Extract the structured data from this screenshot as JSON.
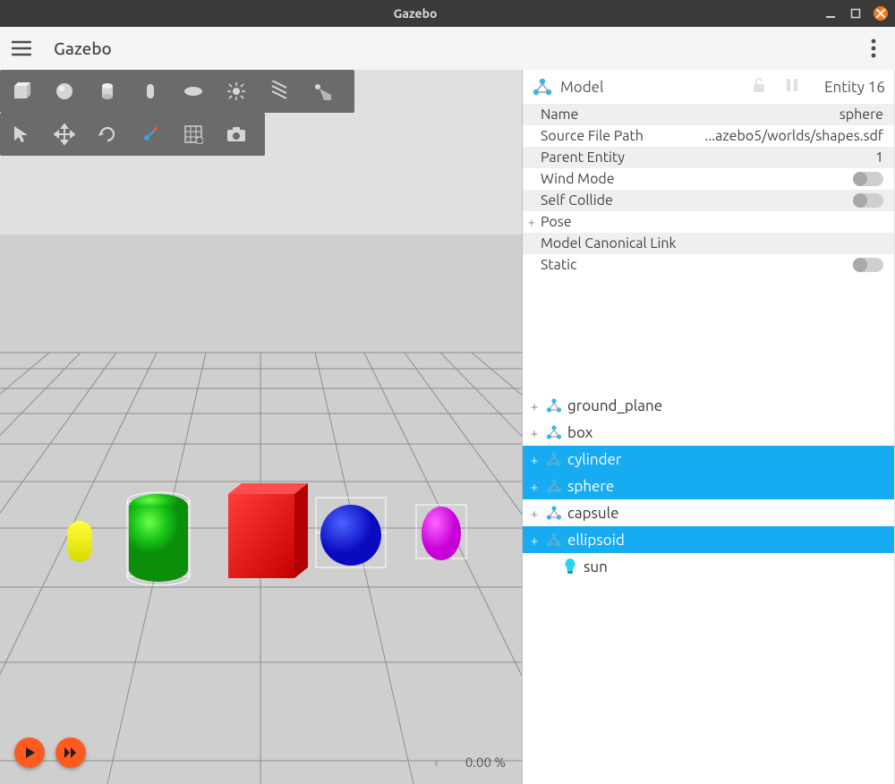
{
  "window": {
    "title": "Gazebo"
  },
  "app": {
    "title": "Gazebo"
  },
  "inspector": {
    "header_label": "Model",
    "entity_label": "Entity 16",
    "props": {
      "name_key": "Name",
      "name_val": "sphere",
      "source_key": "Source File Path",
      "source_val": "...azebo5/worlds/shapes.sdf",
      "parent_key": "Parent Entity",
      "parent_val": "1",
      "wind_key": "Wind Mode",
      "selfcollide_key": "Self Collide",
      "pose_key": "Pose",
      "canonical_key": "Model Canonical Link",
      "static_key": "Static"
    }
  },
  "tree": {
    "items": [
      {
        "label": "ground_plane",
        "type": "model",
        "expandable": true,
        "selected": false
      },
      {
        "label": "box",
        "type": "model",
        "expandable": true,
        "selected": false
      },
      {
        "label": "cylinder",
        "type": "model",
        "expandable": true,
        "selected": true
      },
      {
        "label": "sphere",
        "type": "model",
        "expandable": true,
        "selected": true
      },
      {
        "label": "capsule",
        "type": "model",
        "expandable": true,
        "selected": false
      },
      {
        "label": "ellipsoid",
        "type": "model",
        "expandable": true,
        "selected": true
      },
      {
        "label": "sun",
        "type": "light",
        "expandable": false,
        "selected": false,
        "indent": true
      }
    ]
  },
  "status": {
    "percent": "0.00 %"
  },
  "icons": {
    "toolbar1": [
      "box-icon",
      "sphere-icon",
      "cylinder-icon",
      "capsule-icon",
      "ellipsoid-icon",
      "pointlight-icon",
      "directionallight-icon",
      "spotlight-icon"
    ],
    "toolbar2": [
      "select-icon",
      "translate-icon",
      "rotate-icon",
      "wireframe-icon",
      "grid-icon",
      "camera-icon"
    ]
  }
}
